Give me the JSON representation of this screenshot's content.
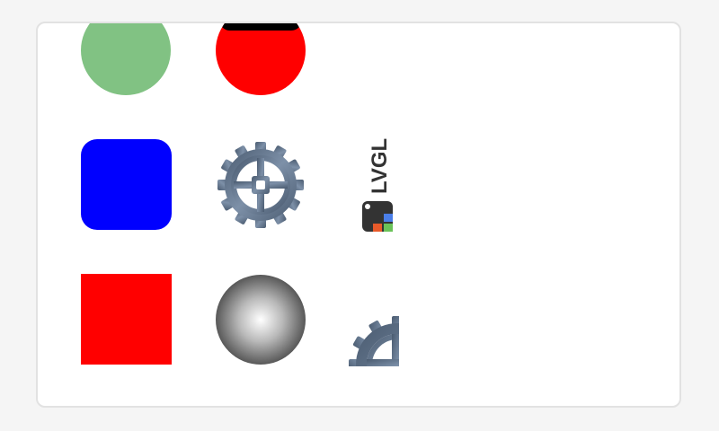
{
  "colors": {
    "page_bg": "#f5f5f5",
    "panel_bg": "#ffffff",
    "panel_border": "#e2e2e2",
    "green_circle": "#81c283",
    "blue_square": "#0000ff",
    "red_square": "#ff0000",
    "arc_blue": "#2196f3",
    "arc_red": "#ff0000",
    "arc_black": "#000000",
    "gear_steel": "#5c6f86"
  },
  "logo": {
    "text": "LVGL"
  },
  "icons": {
    "gear": "gear-icon",
    "gear_corner": "gear-corner-icon",
    "lvgl": "lvgl-logo-icon"
  }
}
